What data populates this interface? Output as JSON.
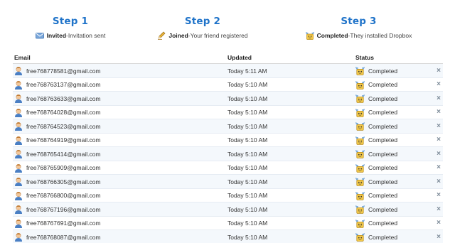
{
  "steps": [
    {
      "title": "Step 1",
      "status": "Invited",
      "sep": " - ",
      "desc": "Invitation sent",
      "icon": "envelope-icon"
    },
    {
      "title": "Step 2",
      "status": "Joined",
      "sep": " - ",
      "desc": "Your friend registered",
      "icon": "pencil-icon"
    },
    {
      "title": "Step 3",
      "status": "Completed",
      "sep": " - ",
      "desc": "They installed Dropbox",
      "icon": "open-box-icon"
    }
  ],
  "table": {
    "headers": {
      "email": "Email",
      "updated": "Updated",
      "status": "Status"
    },
    "rows": [
      {
        "email": "free768778581@gmail.com",
        "updated": "Today 5:11 AM",
        "status": "Completed",
        "remove": "×"
      },
      {
        "email": "free768763137@gmail.com",
        "updated": "Today 5:10 AM",
        "status": "Completed",
        "remove": "×"
      },
      {
        "email": "free768763633@gmail.com",
        "updated": "Today 5:10 AM",
        "status": "Completed",
        "remove": "×"
      },
      {
        "email": "free768764028@gmail.com",
        "updated": "Today 5:10 AM",
        "status": "Completed",
        "remove": "×"
      },
      {
        "email": "free768764523@gmail.com",
        "updated": "Today 5:10 AM",
        "status": "Completed",
        "remove": "×"
      },
      {
        "email": "free768764919@gmail.com",
        "updated": "Today 5:10 AM",
        "status": "Completed",
        "remove": "×"
      },
      {
        "email": "free768765414@gmail.com",
        "updated": "Today 5:10 AM",
        "status": "Completed",
        "remove": "×"
      },
      {
        "email": "free768765909@gmail.com",
        "updated": "Today 5:10 AM",
        "status": "Completed",
        "remove": "×"
      },
      {
        "email": "free768766305@gmail.com",
        "updated": "Today 5:10 AM",
        "status": "Completed",
        "remove": "×"
      },
      {
        "email": "free768766800@gmail.com",
        "updated": "Today 5:10 AM",
        "status": "Completed",
        "remove": "×"
      },
      {
        "email": "free768767196@gmail.com",
        "updated": "Today 5:10 AM",
        "status": "Completed",
        "remove": "×"
      },
      {
        "email": "free768767691@gmail.com",
        "updated": "Today 5:10 AM",
        "status": "Completed",
        "remove": "×"
      },
      {
        "email": "free768768087@gmail.com",
        "updated": "Today 5:10 AM",
        "status": "Completed",
        "remove": "×"
      }
    ]
  },
  "icons": {
    "row_avatar": "user-avatar-icon",
    "row_status": "open-box-icon",
    "row_remove": "close-icon"
  },
  "colors": {
    "step_title": "#1f73c9",
    "row_alt": "#f4f8fc",
    "remove_icon": "#7d8b99"
  }
}
